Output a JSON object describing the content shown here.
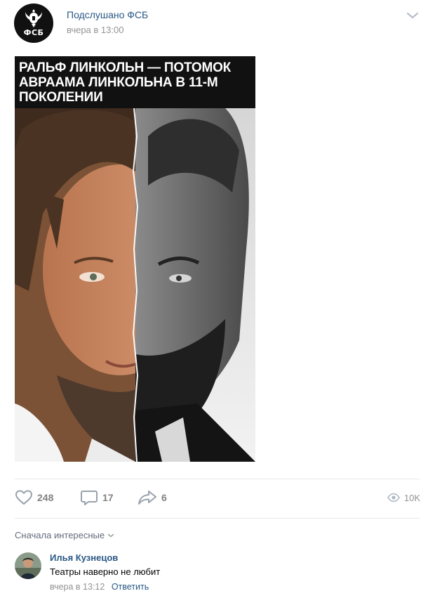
{
  "post": {
    "group_name": "Подслушано ФСБ",
    "date": "вчера в 13:00",
    "logo_text": "ФСБ",
    "image_caption": "РАЛЬФ ЛИНКОЛЬН — ПОТОМОК\nАВРААМА ЛИНКОЛЬНА В 11-М\nПОКОЛЕНИИ"
  },
  "actions": {
    "likes": "248",
    "comments": "17",
    "shares": "6",
    "views": "10K"
  },
  "comments": {
    "sort_label": "Сначала интересные",
    "items": [
      {
        "author": "Илья Кузнецов",
        "text": "Театры наверно не любит",
        "time": "вчера в 13:12",
        "reply_label": "Ответить"
      }
    ]
  },
  "colors": {
    "link": "#2a5885",
    "muted": "#939393",
    "action_icon": "#99a2ad"
  },
  "icons": [
    "chevron-down-icon",
    "heart-icon",
    "comment-icon",
    "share-icon",
    "eye-icon"
  ]
}
